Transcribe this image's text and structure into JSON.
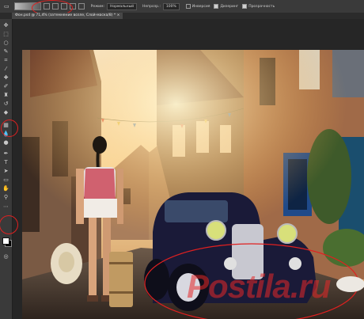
{
  "options_bar": {
    "mode_label": "Режим:",
    "mode_value": "Нормальный",
    "opacity_label": "Непрозр.:",
    "opacity_value": "100%",
    "reverse_label": "Инверсия",
    "dither_label": "Дизеринг",
    "transparency_label": "Прозрачность"
  },
  "document_tab": {
    "title": "Фон.psd @ 71,4% (затемнение возле, Слой-маска/8) *"
  },
  "toolbar": {
    "tools": [
      "move-icon",
      "marquee-icon",
      "lasso-icon",
      "quick-select-icon",
      "crop-icon",
      "eyedropper-icon",
      "healing-brush-icon",
      "brush-icon",
      "clone-stamp-icon",
      "history-brush-icon",
      "eraser-icon",
      "gradient-icon",
      "blur-icon",
      "dodge-icon",
      "pen-icon",
      "type-icon",
      "path-select-icon",
      "shape-icon",
      "hand-icon",
      "zoom-icon",
      "more-tools-icon"
    ],
    "foreground_color": "#ffffff",
    "background_color": "#000000",
    "highlight_color": "#e02020"
  },
  "watermark": {
    "text": "Postila.ru"
  },
  "colors": {
    "ui_dark": "#262626",
    "panel": "#3a3a3a",
    "annotation": "#e02020"
  }
}
